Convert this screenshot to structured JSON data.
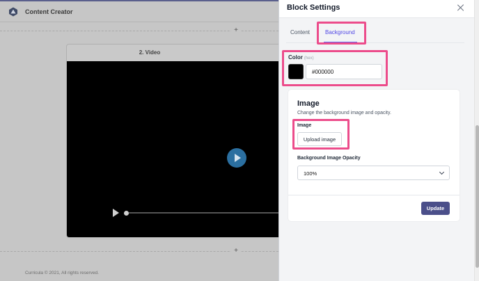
{
  "app": {
    "title": "Content Creator",
    "footer": "Curricula © 2021, All rights reserved.",
    "add_symbol": "+",
    "video_block": {
      "title": "2. Video"
    }
  },
  "panel": {
    "title": "Block Settings",
    "tabs": [
      {
        "label": "Content",
        "active": false
      },
      {
        "label": "Background",
        "active": true
      }
    ],
    "color": {
      "label": "Color",
      "hint": "(hex)",
      "value": "#000000",
      "swatch": "#000000"
    },
    "image_card": {
      "title": "Image",
      "description": "Change the background image and opacity.",
      "image_label": "Image",
      "upload_label": "Upload image",
      "opacity_label": "Background Image Opacity",
      "opacity_value": "100%"
    },
    "update_label": "Update"
  },
  "colors": {
    "accent": "#4f46e5",
    "highlight": "#ec4c8b",
    "update_button": "#4b4f8a"
  }
}
